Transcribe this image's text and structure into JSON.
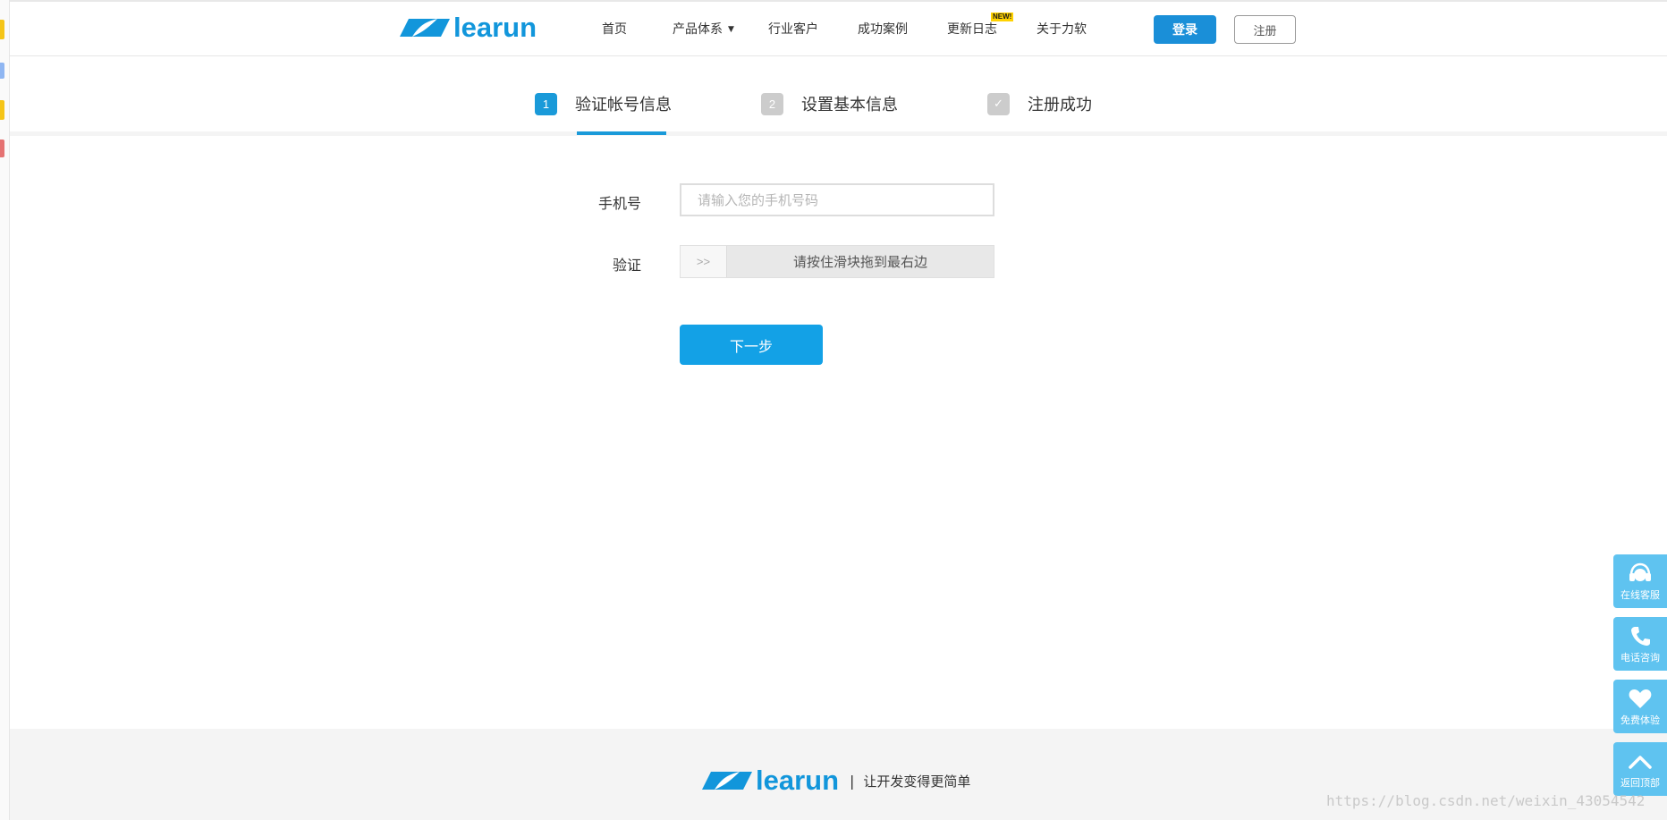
{
  "brand": {
    "name": "learun",
    "color": "#1296db",
    "slogan": "让开发变得更简单",
    "separator": "|"
  },
  "nav": {
    "items": [
      {
        "label": "首页"
      },
      {
        "label": "产品体系",
        "caret": "▼"
      },
      {
        "label": "行业客户"
      },
      {
        "label": "成功案例"
      },
      {
        "label": "更新日志"
      },
      {
        "label": "关于力软"
      }
    ],
    "new_badge": "NEW!",
    "login_label": "登录",
    "register_label": "注册"
  },
  "steps": [
    {
      "num": "1",
      "label": "验证帐号信息",
      "state": "active",
      "color": "#1a9ad9"
    },
    {
      "num": "2",
      "label": "设置基本信息",
      "state": "pending",
      "color": "#cccccc"
    },
    {
      "num": "✓",
      "label": "注册成功",
      "state": "pending",
      "color": "#cccccc"
    }
  ],
  "form": {
    "phone_label": "手机号",
    "phone_placeholder": "请输入您的手机号码",
    "phone_value": "",
    "verify_label": "验证",
    "slider_handle": ">>",
    "slider_text": "请按住滑块拖到最右边",
    "next_label": "下一步"
  },
  "side_widgets": [
    {
      "icon": "headset-icon",
      "label": "在线客服"
    },
    {
      "icon": "phone-icon",
      "label": "电话咨询"
    },
    {
      "icon": "heart-icon",
      "label": "免费体验"
    },
    {
      "icon": "chevron-up-icon",
      "label": "返回顶部"
    }
  ],
  "watermark": "https://blog.csdn.net/weixin_43054542",
  "colors": {
    "accent": "#1a8fd8",
    "primary_button": "#13a1e6",
    "side_widget": "#5fc3f0"
  }
}
